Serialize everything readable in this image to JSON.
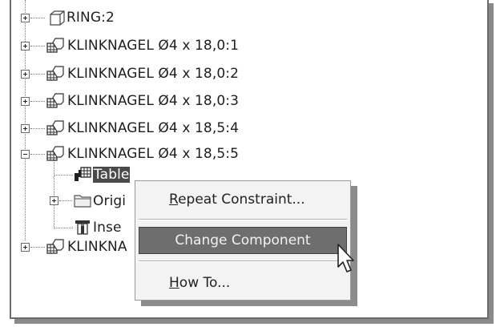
{
  "tree": {
    "items": [
      {
        "label": "RING:2",
        "icon": "part-icon"
      },
      {
        "label": "KLINKNAGEL Ø4 x 18,0:1",
        "icon": "assembly-icon"
      },
      {
        "label": "KLINKNAGEL Ø4 x 18,0:2",
        "icon": "assembly-icon"
      },
      {
        "label": "KLINKNAGEL Ø4 x 18,0:3",
        "icon": "assembly-icon"
      },
      {
        "label": "KLINKNAGEL Ø4 x 18,5:4",
        "icon": "assembly-icon"
      },
      {
        "label": "KLINKNAGEL Ø4 x 18,5:5",
        "icon": "assembly-icon"
      }
    ],
    "children": [
      {
        "label": "Table",
        "icon": "table-constraint-icon",
        "selected": true
      },
      {
        "label": "Origi",
        "icon": "folder-icon"
      },
      {
        "label": "Inse",
        "icon": "insert-constraint-icon"
      }
    ],
    "last_item": {
      "label": "KLINKNA",
      "icon": "assembly-icon"
    }
  },
  "context_menu": {
    "items": [
      {
        "label": "Repeat Constraint...",
        "mnemonic": "R",
        "rest": "epeat Constraint..."
      },
      {
        "label": "Change Component",
        "highlighted": true
      },
      {
        "label": "How To...",
        "mnemonic": "H",
        "rest": "ow To..."
      }
    ]
  },
  "colors": {
    "selection": "#4a4a4a",
    "menu_highlight": "#6e6e6e",
    "menu_background": "#f3f3f3"
  }
}
